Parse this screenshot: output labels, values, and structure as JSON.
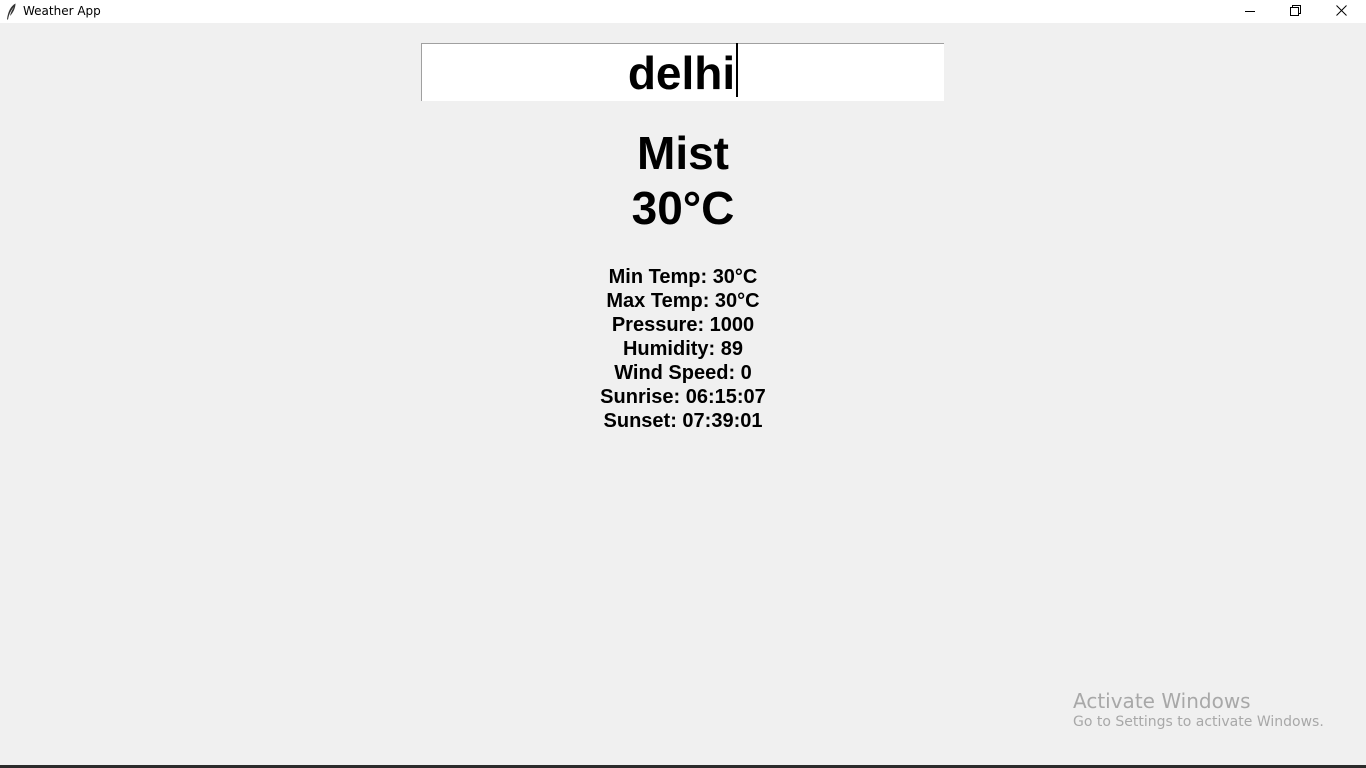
{
  "window": {
    "title": "Weather App",
    "icon": "feather-icon",
    "controls": [
      "minimize-icon",
      "restore-icon",
      "close-icon"
    ]
  },
  "search": {
    "value": "delhi"
  },
  "weather": {
    "condition": "Mist",
    "temperature": "30°C",
    "details": [
      "Min Temp: 30°C",
      "Max Temp: 30°C",
      "Pressure: 1000",
      "Humidity: 89",
      "Wind Speed: 0",
      "Sunrise: 06:15:07",
      "Sunset: 07:39:01"
    ]
  },
  "watermark": {
    "title": "Activate Windows",
    "subtitle": "Go to Settings to activate Windows."
  }
}
